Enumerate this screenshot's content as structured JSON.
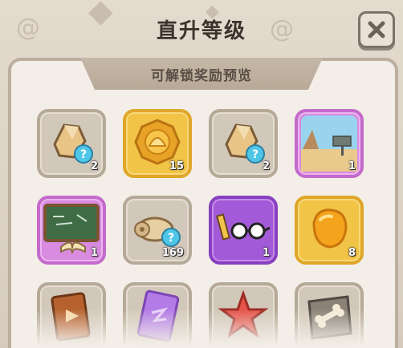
{
  "dialog": {
    "title": "直升等级",
    "subtitle": "可解锁奖励预览"
  },
  "rewards": [
    {
      "icon": "crystal-random-icon",
      "count": "2",
      "rarity": "gray"
    },
    {
      "icon": "gold-shell-coin-icon",
      "count": "15",
      "rarity": "gold"
    },
    {
      "icon": "crystal-random-icon",
      "count": "2",
      "rarity": "gray"
    },
    {
      "icon": "desert-scene-card-icon",
      "count": "1",
      "rarity": "purple"
    },
    {
      "icon": "chalkboard-book-icon",
      "count": "1",
      "rarity": "purple"
    },
    {
      "icon": "fossil-bone-random-icon",
      "count": "169",
      "rarity": "gray"
    },
    {
      "icon": "glasses-pencil-icon",
      "count": "1",
      "rarity": "purple"
    },
    {
      "icon": "amber-stone-icon",
      "count": "8",
      "rarity": "gold"
    },
    {
      "icon": "ticket-play-icon",
      "count": "",
      "rarity": "gray"
    },
    {
      "icon": "purple-card-icon",
      "count": "",
      "rarity": "gray"
    },
    {
      "icon": "red-starfish-icon",
      "count": "",
      "rarity": "gray"
    },
    {
      "icon": "bone-tile-icon",
      "count": "",
      "rarity": "gray"
    }
  ],
  "colors": {
    "gray_tile": "#d2c8ba",
    "gold_tile": "#f1c447",
    "purple_tile": "#d98be0",
    "title_text": "#3b332c"
  }
}
